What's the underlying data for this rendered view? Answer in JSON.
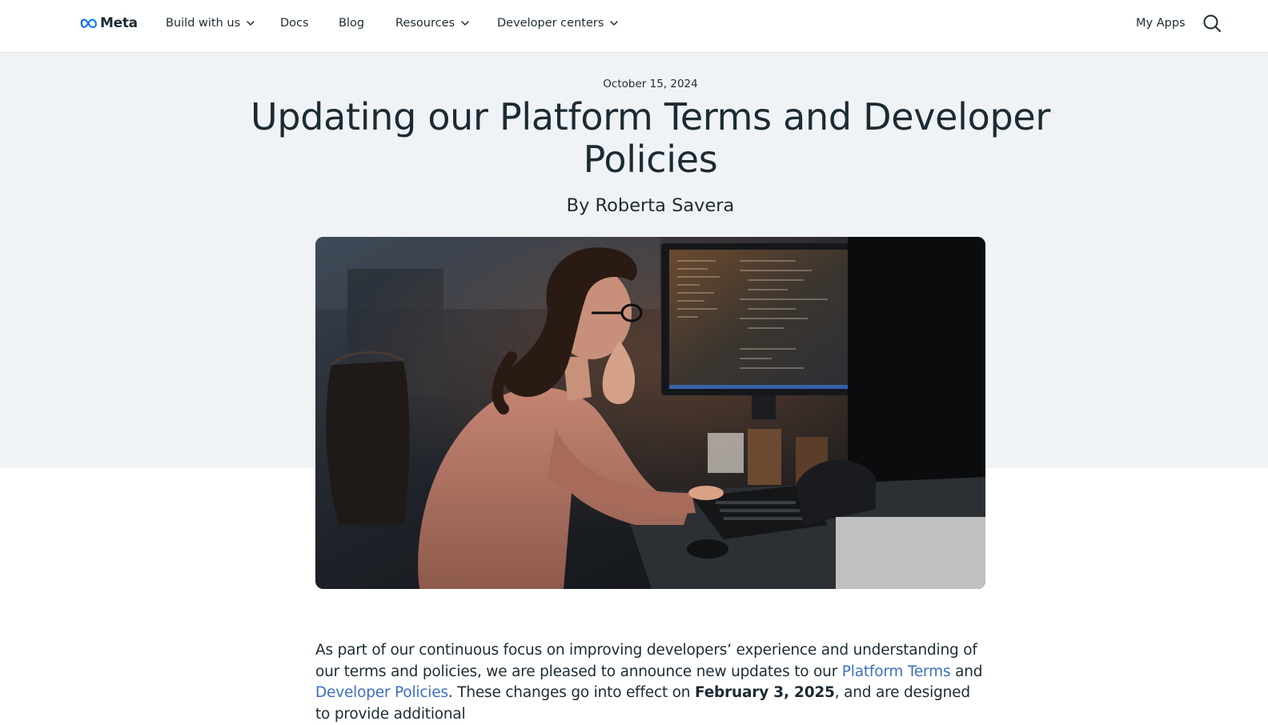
{
  "nav": {
    "logo_label": "Meta",
    "items": [
      {
        "label": "Build with us",
        "dropdown": true
      },
      {
        "label": "Docs",
        "dropdown": false
      },
      {
        "label": "Blog",
        "dropdown": false
      },
      {
        "label": "Resources",
        "dropdown": true
      },
      {
        "label": "Developer centers",
        "dropdown": true
      }
    ],
    "my_apps_label": "My Apps",
    "search_icon": "search-icon"
  },
  "post": {
    "date": "October 15, 2024",
    "title": "Updating our Platform Terms and Developer Policies",
    "author": "By Roberta Savera"
  },
  "body": {
    "intro_1": "As part of our continuous focus on improving developers’ experience and understanding of our terms and policies, we are pleased to announce new updates to our ",
    "link_platform_terms": "Platform Terms",
    "and": " and ",
    "link_developer_policies": "Developer Policies",
    "intro_2": ". These changes go into effect on ",
    "effective_date": "February 3, 2025",
    "intro_3": ", and are designed to provide additional"
  },
  "colors": {
    "text": "#1c2b33",
    "link": "#3b6fc4",
    "hero_bg": "#f0f3f6",
    "meta_blue": "#0668e1"
  }
}
